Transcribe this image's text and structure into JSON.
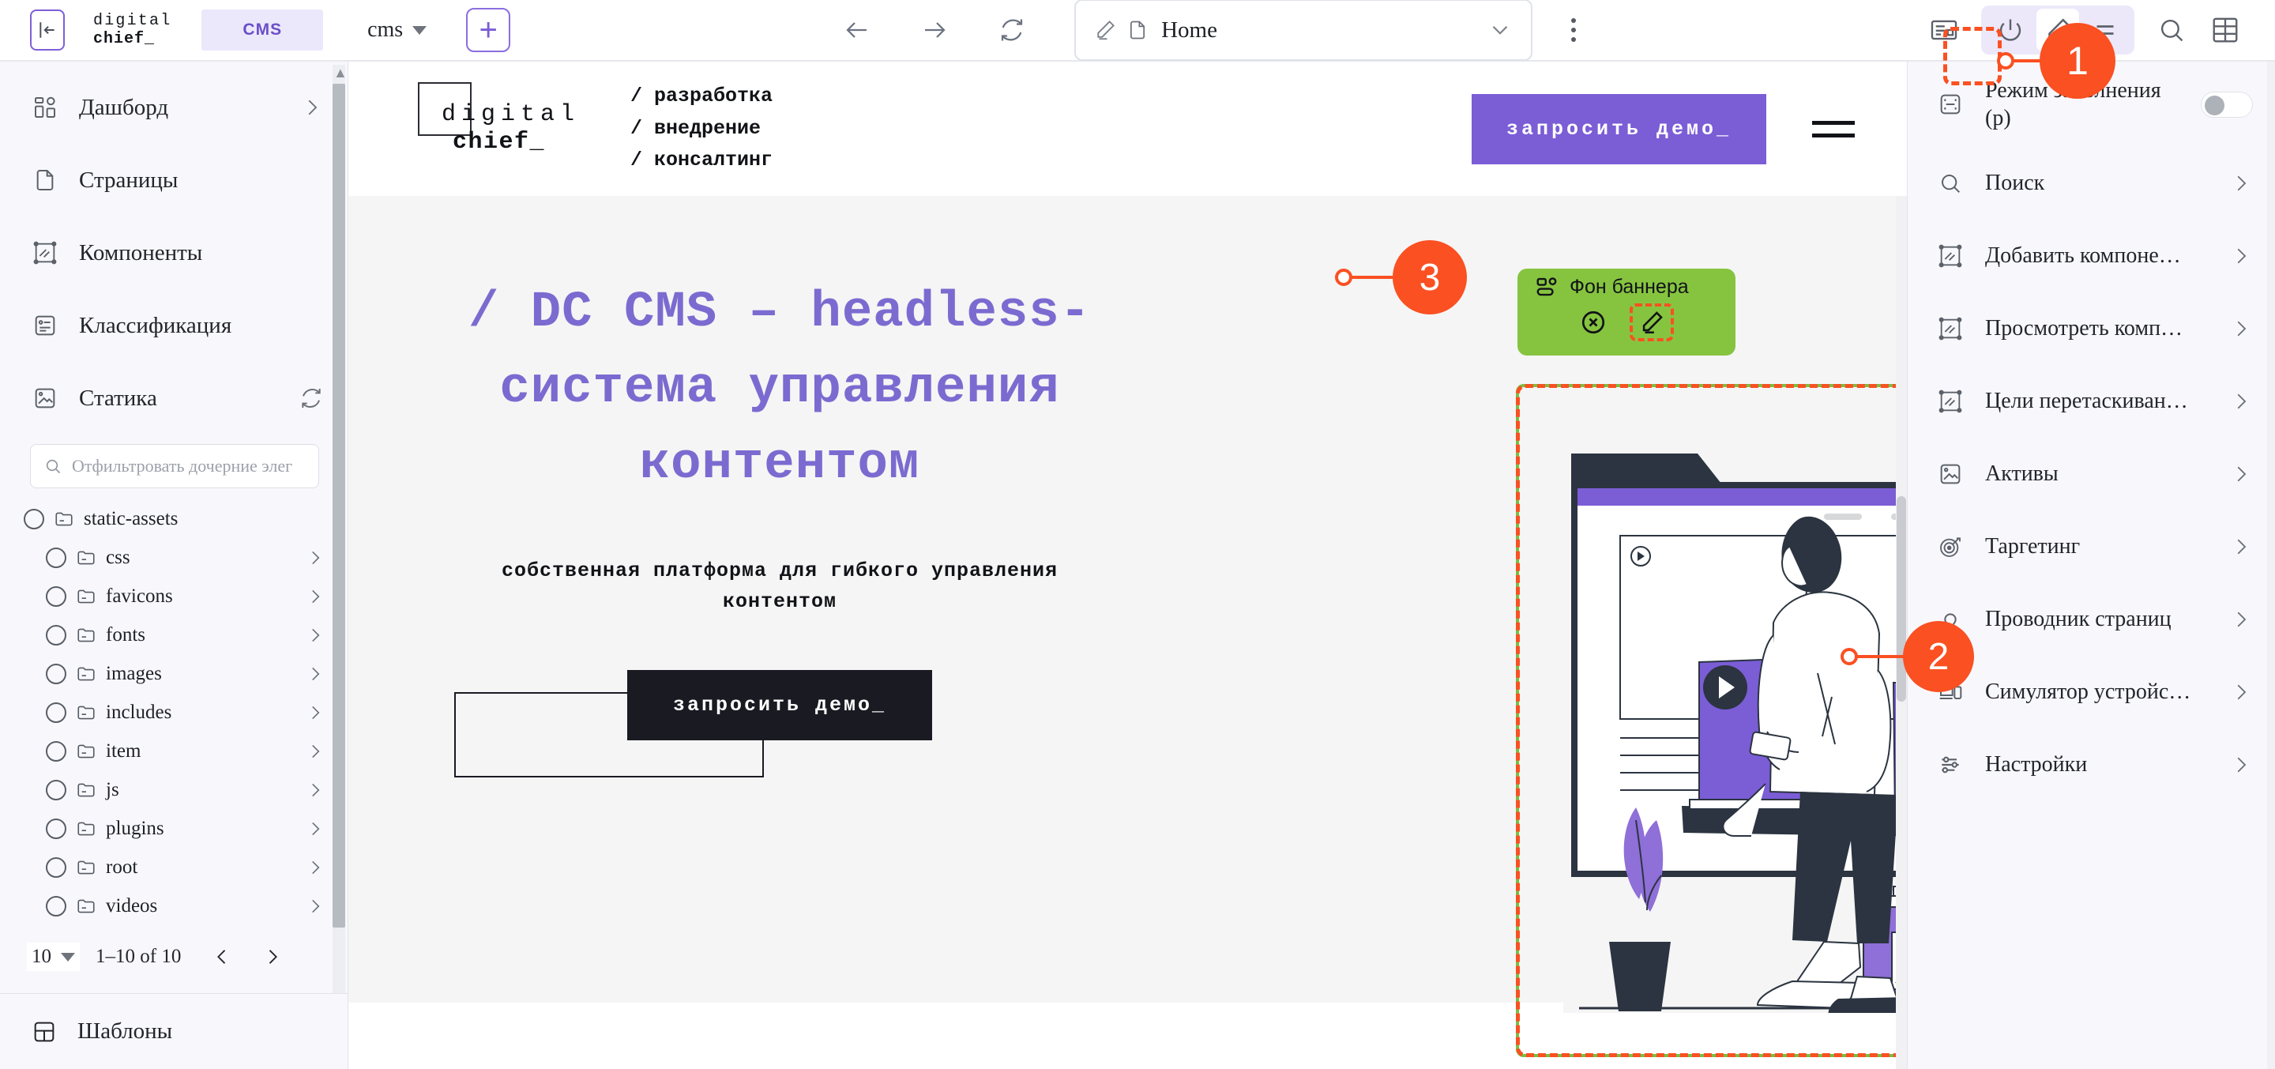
{
  "topbar": {
    "collapse_icon": "panel-collapse-icon",
    "brand_line1": "digital",
    "brand_line2": "chief_",
    "cms_chip": "CMS",
    "space_name": "cms",
    "add_label": "+",
    "nav_back_icon": "arrow-left-icon",
    "nav_forward_icon": "arrow-right-icon",
    "nav_reload_icon": "refresh-icon",
    "page_name": "Home",
    "page_edit_icon": "pencil-icon",
    "page_doc_icon": "document-icon",
    "page_chevron_icon": "chevron-down-icon",
    "kebab_icon": "more-vertical-icon",
    "right_icons": [
      "layout-panel-icon",
      "power-icon",
      "pencil-icon",
      "list-icon",
      "search-icon",
      "grid-icon"
    ]
  },
  "sidebar": {
    "nav": [
      {
        "label": "Дашборд",
        "icon": "dashboard-icon",
        "chevron": true,
        "refresh": false
      },
      {
        "label": "Страницы",
        "icon": "page-icon",
        "chevron": false,
        "refresh": false
      },
      {
        "label": "Компоненты",
        "icon": "component-icon",
        "chevron": false,
        "refresh": false
      },
      {
        "label": "Классификация",
        "icon": "classification-icon",
        "chevron": false,
        "refresh": false
      },
      {
        "label": "Статика",
        "icon": "static-image-icon",
        "chevron": false,
        "refresh": true
      }
    ],
    "filter_placeholder": "Отфильтровать дочерние элег",
    "filter_value": "",
    "filter_icon": "search-icon",
    "tree": [
      {
        "label": "static-assets",
        "depth": 0,
        "chevron": false
      },
      {
        "label": "css",
        "depth": 1,
        "chevron": true
      },
      {
        "label": "favicons",
        "depth": 1,
        "chevron": true
      },
      {
        "label": "fonts",
        "depth": 1,
        "chevron": true
      },
      {
        "label": "images",
        "depth": 1,
        "chevron": true
      },
      {
        "label": "includes",
        "depth": 1,
        "chevron": true
      },
      {
        "label": "item",
        "depth": 1,
        "chevron": true
      },
      {
        "label": "js",
        "depth": 1,
        "chevron": true
      },
      {
        "label": "plugins",
        "depth": 1,
        "chevron": true
      },
      {
        "label": "root",
        "depth": 1,
        "chevron": true
      },
      {
        "label": "videos",
        "depth": 1,
        "chevron": true
      }
    ],
    "pagination": {
      "page_size": "10",
      "range": "1–10 of 10",
      "prev_icon": "chevron-left-icon",
      "next_icon": "chevron-right-icon"
    },
    "footer": {
      "label": "Шаблоны",
      "icon": "template-icon"
    }
  },
  "canvas": {
    "site_header": {
      "logo_line1": "digital",
      "logo_line2": "chief_",
      "nav_items": [
        "/ разработка",
        "/ внедрение",
        "/ консалтинг"
      ],
      "cta": "запросить демо_",
      "burger_icon": "hamburger-menu-icon"
    },
    "hero": {
      "title": "/ DC CMS – headless-система управления контентом",
      "subtitle": "собственная платформа для гибкого управления контентом",
      "cta": "запросить демо_"
    },
    "component_badge": {
      "label": "Фон баннера",
      "type_icon": "component-type-icon",
      "remove_icon": "remove-circle-icon",
      "edit_icon": "pencil-icon"
    },
    "selection_border_color": "#76c043",
    "highlight_color": "#fa5022"
  },
  "rightpanel": {
    "items": [
      {
        "label": "Режим заполнения (p)",
        "icon": "fill-mode-icon",
        "control": "toggle",
        "toggle_on": false
      },
      {
        "label": "Поиск",
        "icon": "search-icon",
        "control": "chevron"
      },
      {
        "label": "Добавить компоне…",
        "icon": "component-icon",
        "control": "chevron"
      },
      {
        "label": "Просмотреть комп…",
        "icon": "component-icon",
        "control": "chevron"
      },
      {
        "label": "Цели перетаскиван…",
        "icon": "component-icon",
        "control": "chevron"
      },
      {
        "label": "Активы",
        "icon": "static-image-icon",
        "control": "chevron"
      },
      {
        "label": "Таргетинг",
        "icon": "target-icon",
        "control": "chevron"
      },
      {
        "label": "Проводник страниц",
        "icon": "page-explorer-icon",
        "control": "chevron"
      },
      {
        "label": "Симулятор устройс…",
        "icon": "device-simulator-icon",
        "control": "chevron"
      },
      {
        "label": "Настройки",
        "icon": "settings-sliders-icon",
        "control": "chevron"
      }
    ]
  },
  "callouts": [
    {
      "number": "1"
    },
    {
      "number": "2"
    },
    {
      "number": "3"
    }
  ]
}
